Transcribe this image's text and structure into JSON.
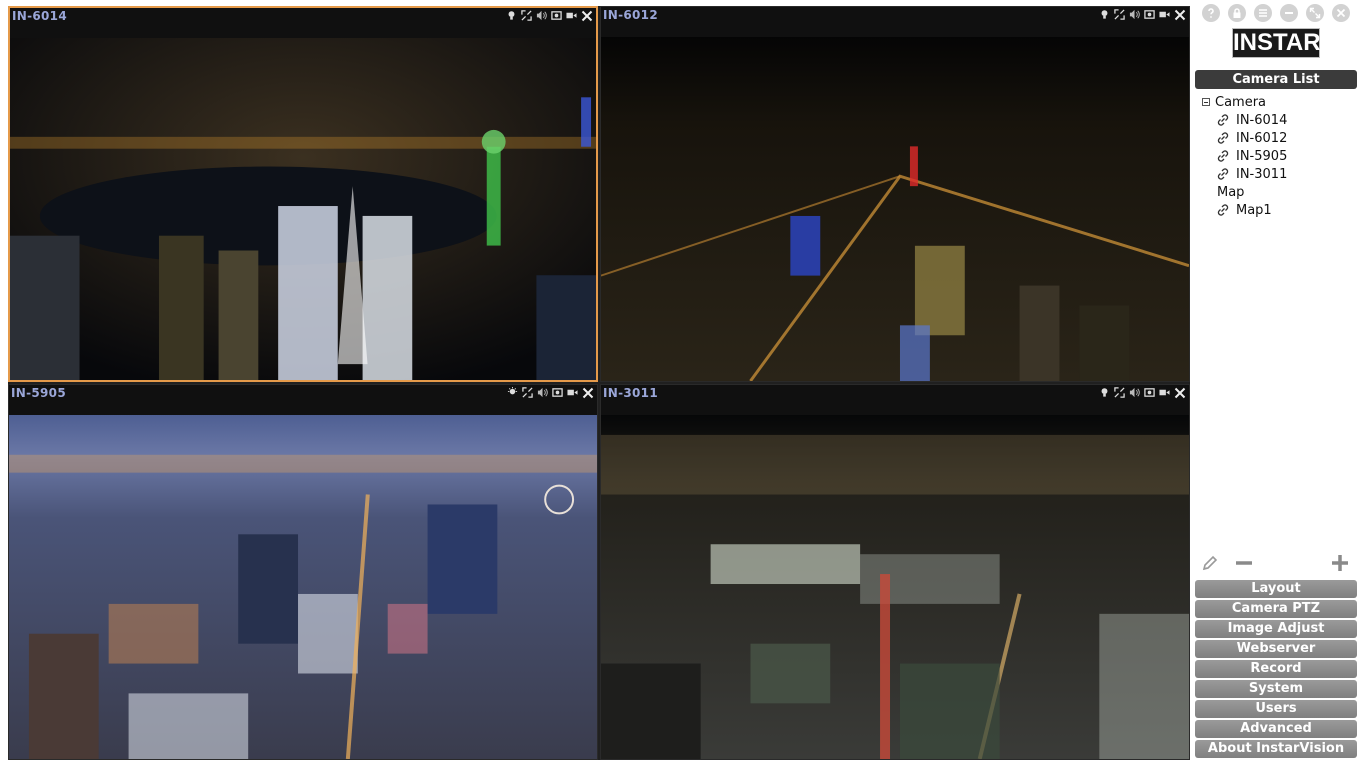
{
  "cameras": [
    {
      "name": "IN-6014",
      "selected": true
    },
    {
      "name": "IN-6012",
      "selected": false
    },
    {
      "name": "IN-5905",
      "selected": false
    },
    {
      "name": "IN-3011",
      "selected": false
    }
  ],
  "tile_controls": [
    "bulb-icon",
    "fullscreen-icon",
    "audio-icon",
    "snapshot-icon",
    "record-icon",
    "close-icon"
  ],
  "panel": {
    "window_buttons": [
      "help-icon",
      "lock-icon",
      "menu-icon",
      "minimize-icon",
      "maximize-icon",
      "close-icon"
    ],
    "logo": "INSTAR",
    "camera_list_title": "Camera List",
    "tree": {
      "camera_group": "Camera",
      "cameras": [
        "IN-6014",
        "IN-6012",
        "IN-5905",
        "IN-3011"
      ],
      "map_group": "Map",
      "maps": [
        "Map1"
      ]
    },
    "menu": [
      "Layout",
      "Camera PTZ",
      "Image Adjust",
      "Webserver",
      "Record",
      "System",
      "Users",
      "Advanced",
      "About InstarVision"
    ]
  },
  "colors": {
    "selected_border": "#e59a4a",
    "camera_label": "#9aa6d8",
    "menu_button": "#8c8c8c",
    "list_header": "#3b3b3b"
  }
}
